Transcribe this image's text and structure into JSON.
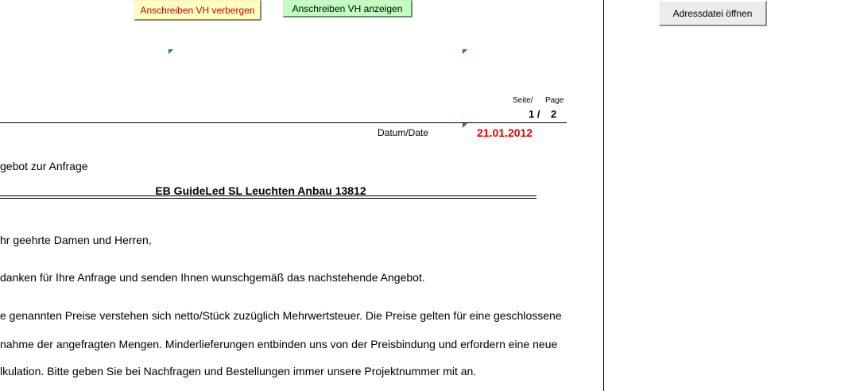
{
  "toolbar": {
    "hide_button": "Anschreiben VH verbergen",
    "show_button": "Anschreiben VH anzeigen",
    "open_address_button": "Adressdatei öffnen"
  },
  "colors": {
    "hide_button_bg": "#ffffc0",
    "show_button_bg": "#c0ffc0",
    "open_button_bg": "#ececec",
    "comment_marker": "#1a8a1a",
    "date_color": "#dd0000"
  },
  "header": {
    "page_label_de": "Seite/",
    "page_label_en": "Page",
    "page_current": "1 /",
    "page_total": "2",
    "date_label": "Datum/Date",
    "date_value": "21.01.2012"
  },
  "letter": {
    "subject_prefix": "gebot zur Anfrage",
    "project_title": "EB GuideLed SL Leuchten Anbau 13812",
    "salutation": "hr geehrte Damen und Herren,",
    "line1": " danken für Ihre Anfrage und senden Ihnen wunschgemäß das nachstehende Angebot.",
    "line2": "e genannten Preise verstehen sich netto/Stück zuzüglich Mehrwertsteuer. Die Preise gelten für eine geschlossene",
    "line3": "nahme der angefragten Mengen. Minderlieferungen entbinden uns von der Preisbindung und erfordern eine neue",
    "line4": "lkulation. Bitte geben Sie bei Nachfragen und Bestellungen immer unsere Projektnummer mit an."
  }
}
